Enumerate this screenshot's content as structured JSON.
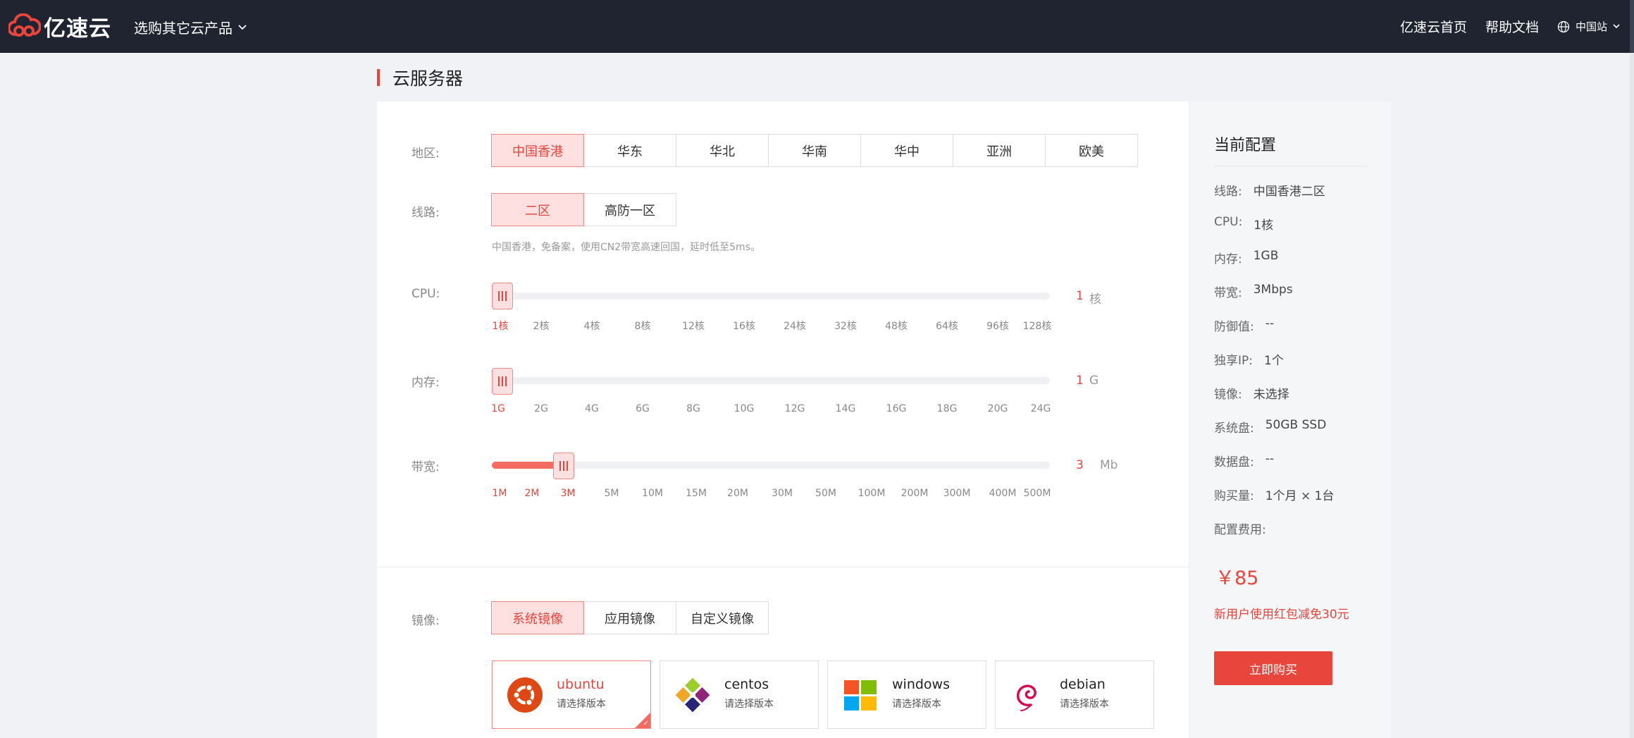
{
  "topbar": {
    "logo_text": "亿速云",
    "product_menu": "选购其它云产品",
    "links": [
      "亿速云首页",
      "帮助文档"
    ],
    "site_selector": "中国站"
  },
  "page": {
    "title": "云服务器"
  },
  "region": {
    "label": "地区:",
    "options": [
      "中国香港",
      "华东",
      "华北",
      "华南",
      "华中",
      "亚洲",
      "欧美"
    ],
    "selected": "中国香港"
  },
  "line": {
    "label": "线路:",
    "options": [
      "二区",
      "高防一区"
    ],
    "selected": "二区",
    "hint": "中国香港，免备案，使用CN2带宽高速回国，延时低至5ms。"
  },
  "cpu": {
    "label": "CPU:",
    "ticks": [
      "1核",
      "2核",
      "4核",
      "8核",
      "12核",
      "16核",
      "24核",
      "32核",
      "48核",
      "64核",
      "96核",
      "128核"
    ],
    "selected_index": 0,
    "value": "1",
    "unit": "核"
  },
  "memory": {
    "label": "内存:",
    "ticks": [
      "1G",
      "2G",
      "4G",
      "6G",
      "8G",
      "10G",
      "12G",
      "14G",
      "16G",
      "18G",
      "20G",
      "24G"
    ],
    "selected_index": 0,
    "value": "1",
    "unit": "G"
  },
  "bandwidth": {
    "label": "带宽:",
    "ticks": [
      "1M",
      "2M",
      "3M",
      "5M",
      "10M",
      "15M",
      "20M",
      "30M",
      "50M",
      "100M",
      "200M",
      "300M",
      "400M",
      "500M"
    ],
    "selected_index": 2,
    "value": "3",
    "unit": "Mb"
  },
  "image": {
    "label": "镜像:",
    "tabs": [
      "系统镜像",
      "应用镜像",
      "自定义镜像"
    ],
    "selected_tab": "系统镜像",
    "items": [
      {
        "name": "ubuntu",
        "sub": "请选择版本",
        "icon": "ubuntu-icon",
        "selected": true
      },
      {
        "name": "centos",
        "sub": "请选择版本",
        "icon": "centos-icon",
        "selected": false
      },
      {
        "name": "windows",
        "sub": "请选择版本",
        "icon": "windows-icon",
        "selected": false
      },
      {
        "name": "debian",
        "sub": "请选择版本",
        "icon": "debian-icon",
        "selected": false
      }
    ]
  },
  "summary": {
    "title": "当前配置",
    "rows": [
      {
        "key": "线路:",
        "value": "中国香港二区"
      },
      {
        "key": "CPU:",
        "value": "1核"
      },
      {
        "key": "内存:",
        "value": "1GB"
      },
      {
        "key": "带宽:",
        "value": "3Mbps"
      },
      {
        "key": "防御值:",
        "value": "--"
      },
      {
        "key": "独享IP:",
        "value": "1个"
      },
      {
        "key": "镜像:",
        "value": "未选择"
      },
      {
        "key": "系统盘:",
        "value": "50GB SSD"
      },
      {
        "key": "数据盘:",
        "value": "--"
      },
      {
        "key": "购买量:",
        "value": "1个月 × 1台"
      },
      {
        "key": "配置费用:",
        "value": ""
      }
    ],
    "price": "￥85",
    "promo": "新用户使用红包减免30元",
    "buy_label": "立即购买"
  },
  "colors": {
    "accent": "#e8453c",
    "accent_light": "#fde0df",
    "topbar": "#1f2430"
  }
}
